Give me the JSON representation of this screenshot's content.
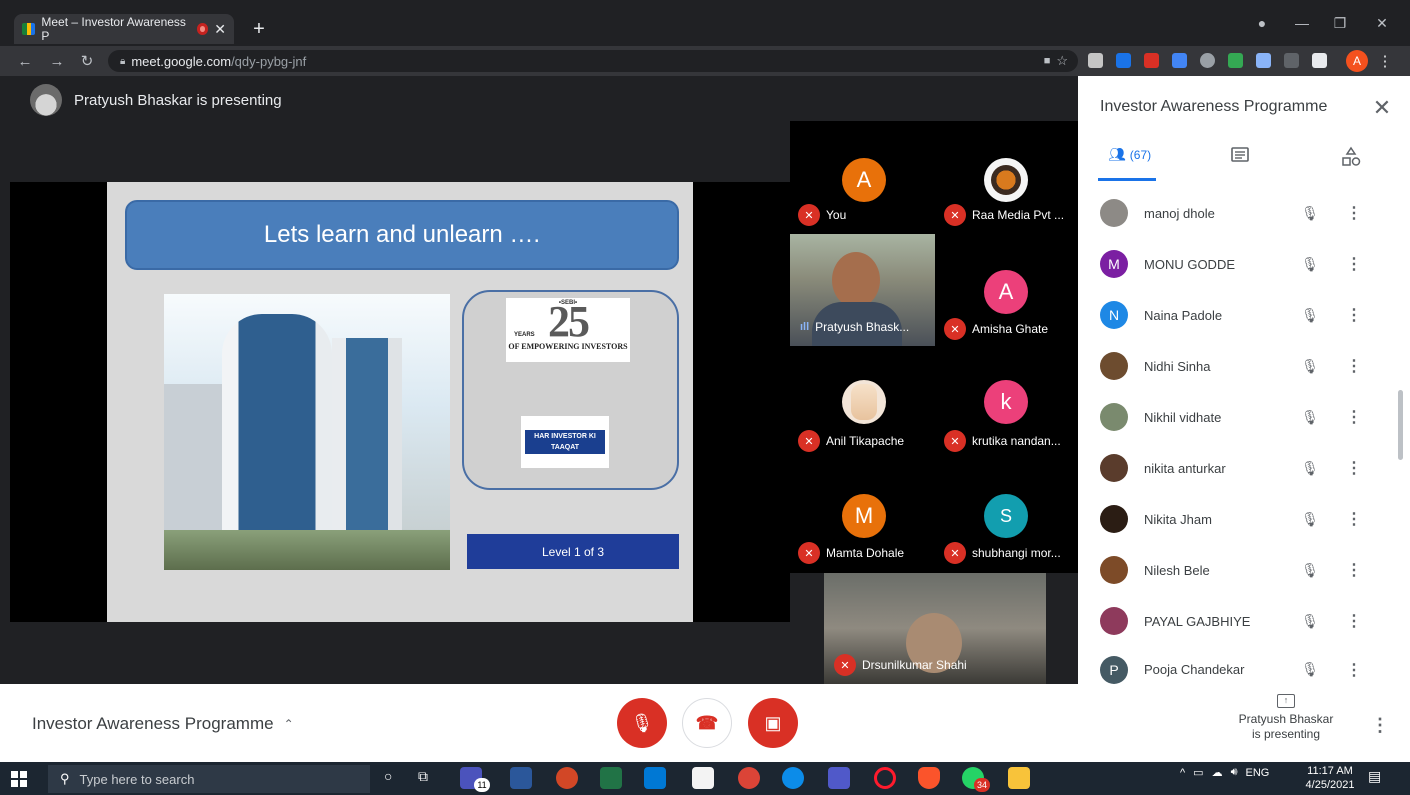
{
  "browser": {
    "tab_title": "Meet – Investor Awareness P",
    "url_host": "meet.google.com",
    "url_path": "/qdy-pybg-jnf"
  },
  "meet": {
    "presenting_banner": "Pratyush Bhaskar is presenting",
    "slide": {
      "title": "Lets learn and unlearn ….",
      "level": "Level 1 of 3",
      "sebi_number": "25",
      "sebi_text": "OF EMPOWERING INVESTORS",
      "sebi_years": "YEARS",
      "sebi_tag": "•SEBI•",
      "investor_logo_text": "HAR INVESTOR KI TAAQAT"
    },
    "tiles": [
      {
        "name": "You",
        "initial": "A",
        "color": "#e8710a"
      },
      {
        "name": "Raa Media Pvt ...",
        "initial": "",
        "color": "#f5f5f5"
      },
      {
        "name": "Pratyush Bhask...",
        "initial": "",
        "color": ""
      },
      {
        "name": "Amisha Ghate",
        "initial": "A",
        "color": "#ec407a"
      },
      {
        "name": "Anil Tikapache",
        "initial": "",
        "color": "#f3e5d8"
      },
      {
        "name": "krutika nandan...",
        "initial": "k",
        "color": "#ec407a"
      },
      {
        "name": "Mamta Dohale",
        "initial": "M",
        "color": "#e8710a"
      },
      {
        "name": "shubhangi mor...",
        "initial": "S",
        "color": "#129eaf"
      },
      {
        "name": "Drsunilkumar Shahi",
        "initial": "",
        "color": ""
      }
    ]
  },
  "panel": {
    "title": "Investor Awareness Programme",
    "people_count": "(67)",
    "participants": [
      {
        "name": "manoj dhole",
        "initial": "",
        "color": "#8d8a86"
      },
      {
        "name": "MONU GODDE",
        "initial": "M",
        "color": "#7b1fa2"
      },
      {
        "name": "Naina Padole",
        "initial": "N",
        "color": "#1e88e5"
      },
      {
        "name": "Nidhi Sinha",
        "initial": "",
        "color": "#6d4c2f"
      },
      {
        "name": "Nikhil vidhate",
        "initial": "",
        "color": "#7a8a6e"
      },
      {
        "name": "nikita anturkar",
        "initial": "",
        "color": "#5a3c2c"
      },
      {
        "name": "Nikita Jham",
        "initial": "",
        "color": "#2b1d14"
      },
      {
        "name": "Nilesh Bele",
        "initial": "",
        "color": "#7d4b28"
      },
      {
        "name": "PAYAL GAJBHIYE",
        "initial": "",
        "color": "#8e3a5c"
      },
      {
        "name": "Pooja Chandekar",
        "initial": "P",
        "color": "#455a64"
      }
    ]
  },
  "bottom": {
    "meeting_name": "Investor Awareness Programme",
    "present_line1": "Pratyush Bhaskar",
    "present_line2": "is presenting"
  },
  "taskbar": {
    "search_placeholder": "Type here to search",
    "lang": "ENG",
    "time": "11:17 AM",
    "date": "4/25/2021",
    "teams_badge": "11",
    "whatsapp_badge": "34"
  },
  "colors": {
    "accent": "#1a73e8",
    "danger": "#d93025",
    "brand_slide": "#4a7ebb"
  }
}
